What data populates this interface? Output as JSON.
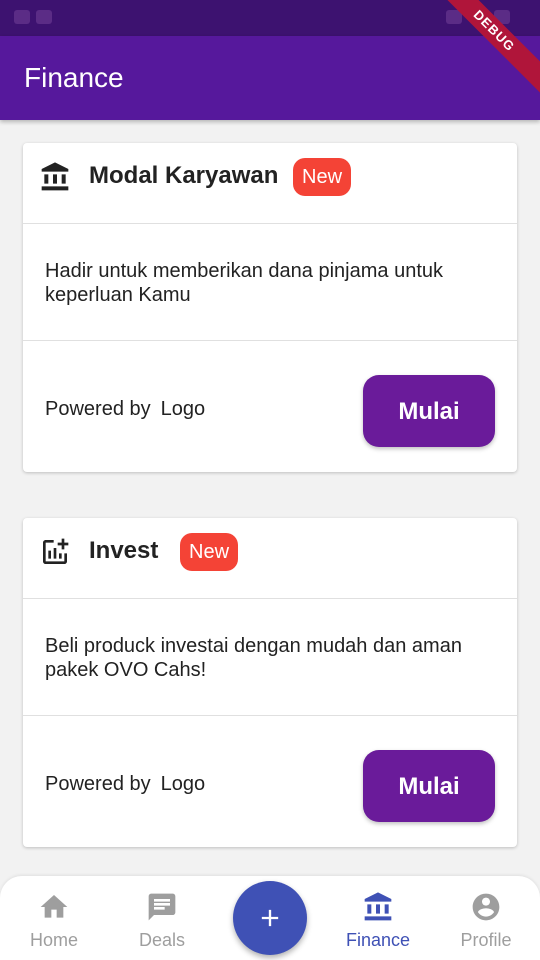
{
  "app_bar": {
    "title": "Finance",
    "debug_label": "DEBUG"
  },
  "colors": {
    "primary": "#56189c",
    "status_bar": "#3d1270",
    "button": "#6a1b9a",
    "badge": "#f44336",
    "nav_active": "#3f51b5",
    "nav_inactive": "#9e9e9e"
  },
  "cards": [
    {
      "icon": "bank-icon",
      "title": "Modal Karyawan",
      "badge": "New",
      "description": "Hadir untuk memberikan dana pinjama untuk keperluan Kamu",
      "powered_by": "Powered by",
      "logo": "Logo",
      "button_label": "Mulai"
    },
    {
      "icon": "chart-add-icon",
      "title": "Invest",
      "badge": "New",
      "description": "Beli produck investai dengan mudah dan aman pakek OVO Cahs!",
      "powered_by": "Powered by",
      "logo": "Logo",
      "button_label": "Mulai"
    }
  ],
  "bottom_nav": {
    "items": [
      {
        "label": "Home",
        "icon": "home-icon",
        "active": false
      },
      {
        "label": "Deals",
        "icon": "message-icon",
        "active": false
      },
      {
        "label": "Finance",
        "icon": "bank-icon",
        "active": true
      },
      {
        "label": "Profile",
        "icon": "account-icon",
        "active": false
      }
    ],
    "fab_icon": "plus-icon"
  }
}
